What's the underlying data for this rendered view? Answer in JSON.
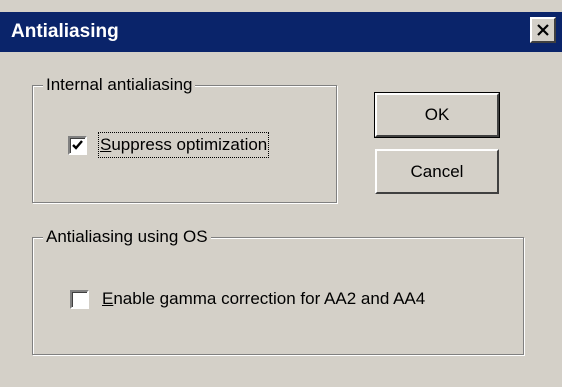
{
  "window": {
    "title": "Antialiasing"
  },
  "group_internal": {
    "label": "Internal antialiasing",
    "checkbox": {
      "label_access": "S",
      "label_rest": "uppress optimization",
      "checked": true
    }
  },
  "group_os": {
    "label": "Antialiasing using OS",
    "checkbox": {
      "label_access": "E",
      "label_rest": "nable gamma correction for AA2 and AA4",
      "checked": false
    }
  },
  "buttons": {
    "ok": "OK",
    "cancel": "Cancel"
  },
  "icons": {
    "close": "close-icon",
    "check": "checkmark-icon"
  }
}
